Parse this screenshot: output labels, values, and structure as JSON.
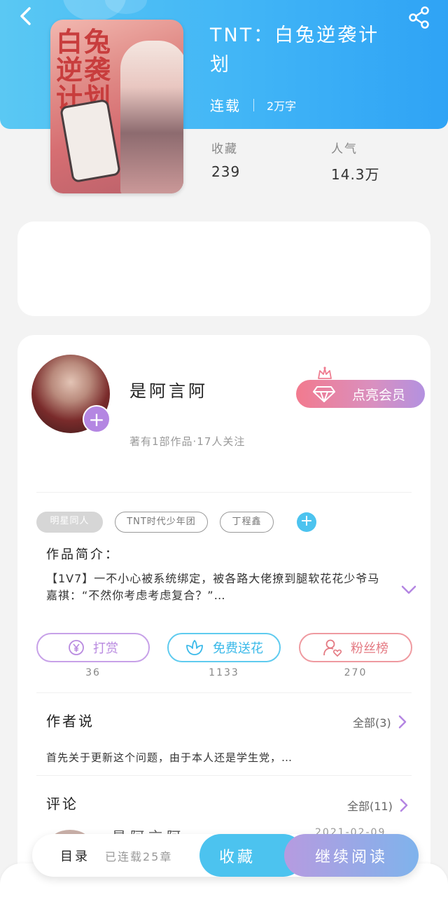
{
  "book": {
    "title": "TNT：白兔逆袭计划",
    "status": "连载",
    "word_count": "2万字",
    "cover_title": "白兔逆袭计划"
  },
  "stats": [
    {
      "label": "收藏",
      "value": "239"
    },
    {
      "label": "人气",
      "value": "14.3万"
    }
  ],
  "author": {
    "name": "是阿言阿",
    "meta": "著有1部作品·17人关注",
    "vip_label": "点亮会员"
  },
  "tags": [
    "明星同人",
    "TNT时代少年团",
    "丁程鑫"
  ],
  "intro": {
    "title": "作品简介：",
    "text": "【1V7】一不小心被系统绑定，被各路大佬撩到腿软花花少爷马嘉祺：“不然你考虑考虑复合？”…"
  },
  "actions": [
    {
      "label": "打赏",
      "count": "36",
      "icon": "yen-coin-icon"
    },
    {
      "label": "免费送花",
      "count": "1133",
      "icon": "flower-icon"
    },
    {
      "label": "粉丝榜",
      "count": "270",
      "icon": "user-heart-icon"
    }
  ],
  "author_says": {
    "title": "作者说",
    "more": "全部(3)",
    "preview": "首先关于更新这个问题，由于本人还是学生党，…"
  },
  "comments": {
    "title": "评论",
    "more": "全部(11)",
    "peek_name": "是阿言阿",
    "peek_date": "2021-02-09"
  },
  "bottom_bar": {
    "toc": "目录",
    "chapters": "已连载25章",
    "favorite": "收藏",
    "continue": "继续阅读"
  },
  "colors": {
    "header_blue": "#41b5f6",
    "accent_purple": "#b486e2",
    "accent_cyan": "#4cc3ef",
    "accent_pink": "#e47a83"
  }
}
